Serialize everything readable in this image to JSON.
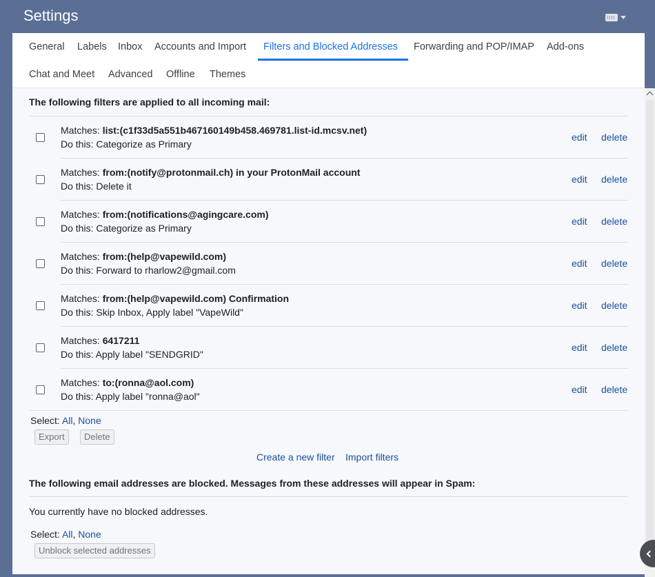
{
  "header": {
    "title": "Settings",
    "keyboard_icon": "keyboard-icon"
  },
  "tabs": [
    {
      "label": "General"
    },
    {
      "label": "Labels"
    },
    {
      "label": "Inbox"
    },
    {
      "label": "Accounts and Import"
    },
    {
      "label": "Filters and Blocked Addresses",
      "active": true
    },
    {
      "label": "Forwarding and POP/IMAP"
    },
    {
      "label": "Add-ons"
    },
    {
      "label": "Chat and Meet"
    },
    {
      "label": "Advanced"
    },
    {
      "label": "Offline"
    },
    {
      "label": "Themes"
    }
  ],
  "filters_section": {
    "heading": "The following filters are applied to all incoming mail:",
    "matches_prefix": "Matches: ",
    "action_prefix": "Do this: ",
    "edit_label": "edit",
    "delete_label": "delete",
    "filters": [
      {
        "criteria": "list:(c1f33d5a551b467160149b458.469781.list-id.mcsv.net)",
        "criteria_suffix": "",
        "action": "Categorize as Primary"
      },
      {
        "criteria": "from:(notify@protonmail.ch) in your ProtonMail account",
        "criteria_suffix": "",
        "action": "Delete it"
      },
      {
        "criteria": "from:(notifications@agingcare.com)",
        "criteria_suffix": "",
        "action": "Categorize as Primary"
      },
      {
        "criteria": "from:(help@vapewild.com)",
        "criteria_suffix": "",
        "action": "Forward to rharlow2@gmail.com"
      },
      {
        "criteria": "from:(help@vapewild.com) Confirmation",
        "criteria_suffix": "",
        "action": "Skip Inbox, Apply label \"VapeWild\""
      },
      {
        "criteria": "6417211",
        "criteria_suffix": "",
        "action": "Apply label \"SENDGRID\""
      },
      {
        "criteria": "to:(ronna@aol.com)",
        "criteria_suffix": "",
        "action": "Apply label \"ronna@aol\""
      }
    ],
    "select_label": "Select:",
    "select_all": "All",
    "select_separator": ",",
    "select_none": "None",
    "export_button": "Export",
    "delete_button": "Delete",
    "create_filter_link": "Create a new filter",
    "import_filters_link": "Import filters"
  },
  "blocked_section": {
    "heading": "The following email addresses are blocked. Messages from these addresses will appear in Spam:",
    "empty_message": "You currently have no blocked addresses.",
    "select_label": "Select:",
    "select_all": "All",
    "select_separator": ",",
    "select_none": "None",
    "unblock_button": "Unblock selected addresses"
  },
  "colors": {
    "header_bg": "#5b6f95",
    "accent": "#1a73e8",
    "link": "#1a4f9c"
  }
}
